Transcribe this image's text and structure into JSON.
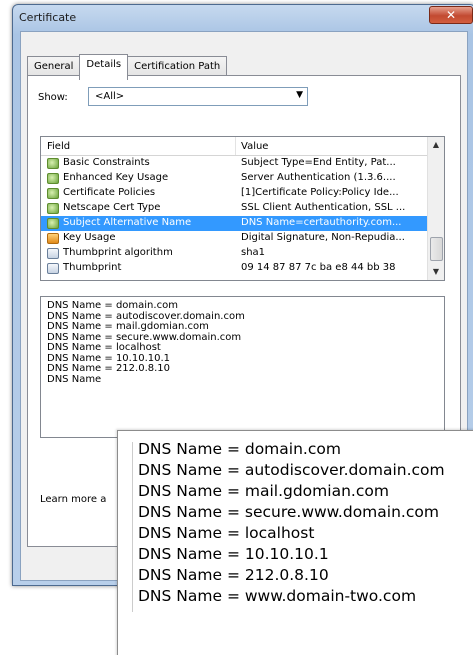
{
  "window": {
    "title": "Certificate",
    "close_glyph": "✕"
  },
  "tabs": [
    {
      "label": "General",
      "active": false
    },
    {
      "label": "Details",
      "active": true
    },
    {
      "label": "Certification Path",
      "active": false
    }
  ],
  "show": {
    "label": "Show:",
    "value": "<All>",
    "arrow": "▼"
  },
  "list": {
    "columns": {
      "field": "Field",
      "value": "Value"
    },
    "rows": [
      {
        "field": "Basic Constraints",
        "value": "Subject Type=End Entity, Pat...",
        "icon": "cert-extension-icon",
        "selected": false
      },
      {
        "field": "Enhanced Key Usage",
        "value": "Server Authentication (1.3.6....",
        "icon": "cert-extension-icon",
        "selected": false
      },
      {
        "field": "Certificate Policies",
        "value": "[1]Certificate Policy:Policy Ide...",
        "icon": "cert-extension-icon",
        "selected": false
      },
      {
        "field": "Netscape Cert Type",
        "value": "SSL Client Authentication, SSL ...",
        "icon": "cert-extension-icon",
        "selected": false
      },
      {
        "field": "Subject Alternative Name",
        "value": "DNS Name=certauthority.com...",
        "icon": "cert-extension-icon",
        "selected": true
      },
      {
        "field": "Key Usage",
        "value": "Digital Signature, Non-Repudia...",
        "icon": "cert-warning-icon",
        "selected": false
      },
      {
        "field": "Thumbprint algorithm",
        "value": "sha1",
        "icon": "document-icon",
        "selected": false
      },
      {
        "field": "Thumbprint",
        "value": "09 14 87 87 7c ba e8 44 bb 38",
        "icon": "document-icon",
        "selected": false
      }
    ],
    "scroll_up": "▲",
    "scroll_down": "▼"
  },
  "detail": {
    "lines": [
      "DNS Name = domain.com",
      "DNS Name = autodiscover.domain.com",
      "DNS Name = mail.gdomian.com",
      "DNS Name = secure.www.domain.com",
      "DNS Name = localhost",
      "DNS Name = 10.10.10.1",
      "DNS Name = 212.0.8.10",
      "DNS Name"
    ]
  },
  "learn_more": "Learn more a",
  "zoom": {
    "lines": [
      "DNS Name = domain.com",
      "DNS Name = autodiscover.domain.com",
      "DNS Name = mail.gdomian.com",
      "DNS Name = secure.www.domain.com",
      "DNS Name = localhost",
      "DNS Name = 10.10.10.1",
      "DNS Name = 212.0.8.10",
      "DNS Name = www.domain-two.com"
    ]
  }
}
